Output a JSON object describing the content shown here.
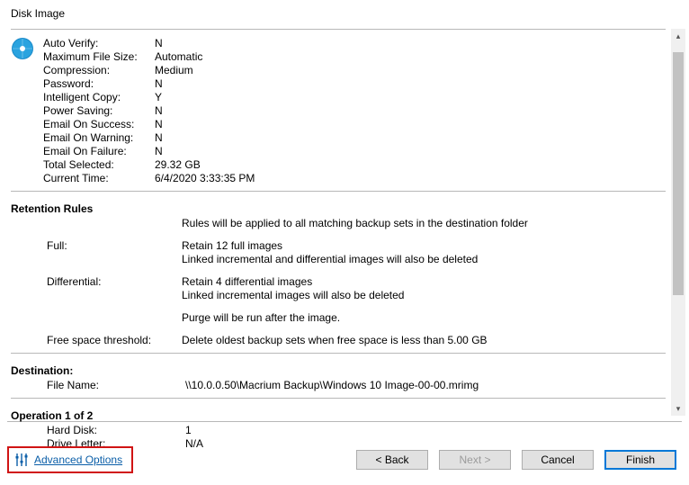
{
  "title": "Disk Image",
  "summary": {
    "auto_verify_label": "Auto Verify:",
    "auto_verify": "N",
    "max_size_label": "Maximum File Size:",
    "max_size": "Automatic",
    "compression_label": "Compression:",
    "compression": "Medium",
    "password_label": "Password:",
    "password": "N",
    "intelligent_copy_label": "Intelligent Copy:",
    "intelligent_copy": "Y",
    "power_saving_label": "Power Saving:",
    "power_saving": "N",
    "email_success_label": "Email On Success:",
    "email_success": "N",
    "email_warning_label": "Email On Warning:",
    "email_warning": "N",
    "email_failure_label": "Email On Failure:",
    "email_failure": "N",
    "total_selected_label": "Total Selected:",
    "total_selected": "29.32 GB",
    "current_time_label": "Current Time:",
    "current_time": "6/4/2020 3:33:35 PM"
  },
  "retention": {
    "header": "Retention Rules",
    "intro": "Rules will be applied to all matching backup sets in the destination folder",
    "full_label": "Full:",
    "full_line1": "Retain 12 full images",
    "full_line2": "Linked incremental and differential images will also be deleted",
    "diff_label": "Differential:",
    "diff_line1": "Retain 4 differential images",
    "diff_line2": "Linked incremental images will also be deleted",
    "purge": "Purge will be run after the image.",
    "threshold_label": "Free space threshold:",
    "threshold_value": "Delete oldest backup sets when free space is less than 5.00 GB"
  },
  "destination": {
    "header": "Destination:",
    "filename_label": "File Name:",
    "filename": "\\\\10.0.0.50\\Macrium Backup\\Windows 10 Image-00-00.mrimg"
  },
  "operation": {
    "header": "Operation 1 of 2",
    "harddisk_label": "Hard Disk:",
    "harddisk": "1",
    "drive_letter_label": "Drive Letter:",
    "drive_letter": "N/A"
  },
  "footer": {
    "advanced": "Advanced Options",
    "back": "< Back",
    "next": "Next >",
    "cancel": "Cancel",
    "finish": "Finish"
  }
}
